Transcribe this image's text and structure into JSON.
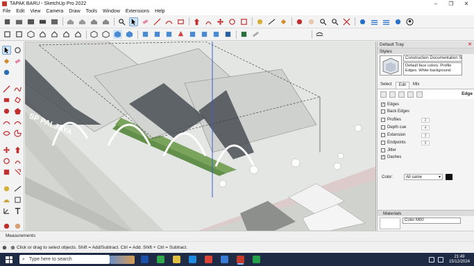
{
  "window": {
    "title": "TAPAK BARU - SketchUp Pro 2022",
    "minimize": "–",
    "maximize": "❐",
    "close": "✕"
  },
  "menu": [
    "File",
    "Edit",
    "View",
    "Camera",
    "Draw",
    "Tools",
    "Window",
    "Extensions",
    "Help"
  ],
  "viewport": {
    "sign_text": "SP PALJAYA"
  },
  "tray": {
    "title": "Default Tray",
    "styles_panel": "Styles",
    "style_name": "Construction Documentation Sty",
    "style_description": "Default face colors. Profile Edges. White background.",
    "tabs": [
      "Select",
      "Edit",
      "Mix"
    ],
    "active_tab": "Edit",
    "edge_title": "Edge",
    "options": [
      {
        "label": "Edges",
        "checked": true,
        "value": ""
      },
      {
        "label": "Back Edges",
        "checked": false,
        "value": ""
      },
      {
        "label": "Profiles",
        "checked": false,
        "value": "2"
      },
      {
        "label": "Depth cue",
        "checked": false,
        "value": "4"
      },
      {
        "label": "Extension",
        "checked": false,
        "value": "3"
      },
      {
        "label": "Endpoints",
        "checked": false,
        "value": "9"
      },
      {
        "label": "Jitter",
        "checked": false,
        "value": ""
      },
      {
        "label": "Dashes",
        "checked": true,
        "value": ""
      }
    ],
    "color_label": "Color:",
    "color_value": "All same",
    "color_swatch": "#111111",
    "materials_panel": "Materials",
    "material_name": "Color M00"
  },
  "status": {
    "measurements_label": "Measurements",
    "hint": "Click or drag to select objects. Shift = Add/Subtract. Ctrl = Add. Shift + Ctrl = Subtract."
  },
  "taskbar": {
    "search_placeholder": "Type here to search",
    "time": "21:49",
    "date": "15/12/2024"
  }
}
